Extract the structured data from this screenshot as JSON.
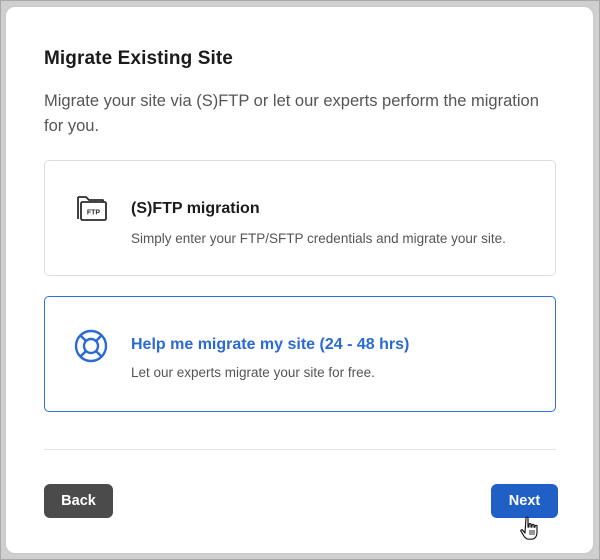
{
  "dialog": {
    "title": "Migrate Existing Site",
    "subtitle": "Migrate your site via (S)FTP or let our experts perform the migration for you."
  },
  "options": [
    {
      "icon": "ftp-folder-icon",
      "icon_label": "FTP",
      "title": "(S)FTP migration",
      "description": "Simply enter your FTP/SFTP credentials and migrate your site.",
      "selected": false
    },
    {
      "icon": "lifebuoy-icon",
      "title": "Help me migrate my site (24 - 48 hrs)",
      "description": "Let our experts migrate your site for free.",
      "selected": true
    }
  ],
  "buttons": {
    "back_label": "Back",
    "next_label": "Next"
  },
  "colors": {
    "accent": "#2a6ad2",
    "next_button": "#1f5fc6",
    "back_button": "#4b4b4b",
    "selected_border": "#2f6fd6"
  }
}
